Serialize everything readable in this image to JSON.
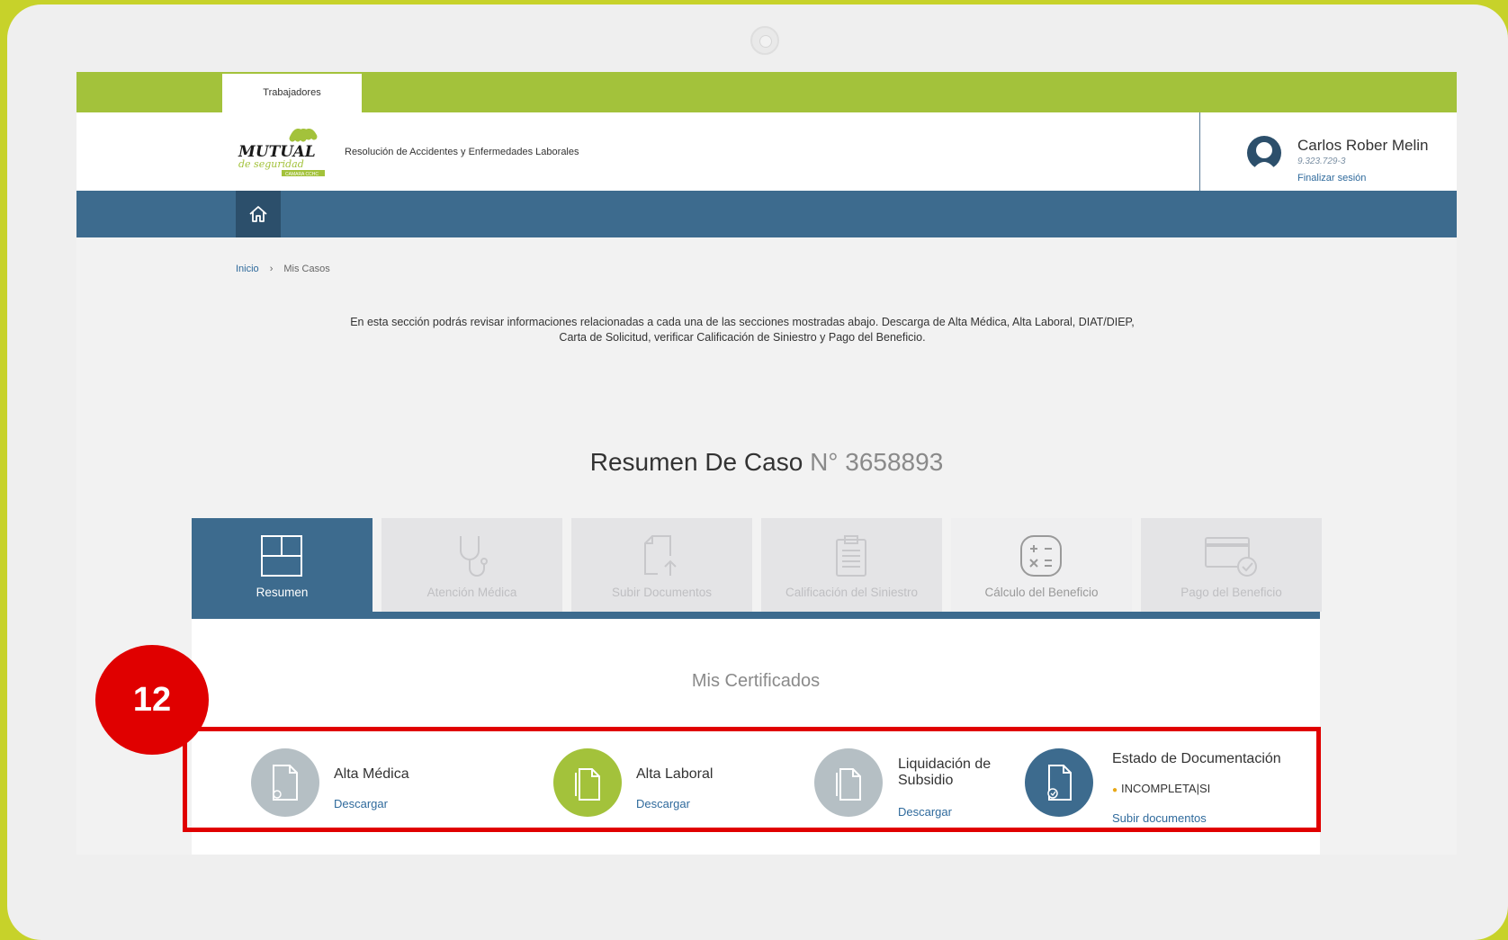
{
  "topbar": {
    "tab_label": "Trabajadores"
  },
  "header": {
    "logo": {
      "line1": "MUTUAL",
      "line2": "de seguridad",
      "tag": "CAMARA CCHC"
    },
    "subtitle": "Resolución de Accidentes y Enfermedades Laborales"
  },
  "user": {
    "name": "Carlos Rober Melin",
    "rut": "9.323.729-3",
    "logout_label": "Finalizar sesión"
  },
  "nav": {
    "home_icon": "home-icon"
  },
  "breadcrumb": {
    "home": "Inicio",
    "separator": "›",
    "current": "Mis Casos"
  },
  "intro": {
    "line1": "En esta sección podrás revisar informaciones relacionadas a cada una de las secciones mostradas abajo. Descarga de Alta Médica, Alta Laboral, DIAT/DIEP,",
    "line2": "Carta de Solicitud, verificar Calificación de Siniestro y Pago del Beneficio."
  },
  "case": {
    "title": "Resumen De Caso",
    "number": "N° 3658893"
  },
  "tabs": [
    {
      "label": "Resumen",
      "icon": "layout-grid-icon",
      "active": true
    },
    {
      "label": "Atención Médica",
      "icon": "stethoscope-icon",
      "active": false
    },
    {
      "label": "Subir Documentos",
      "icon": "upload-document-icon",
      "active": false
    },
    {
      "label": "Calificación del Siniestro",
      "icon": "clipboard-icon",
      "active": false
    },
    {
      "label": "Cálculo del Beneficio",
      "icon": "calculator-icon",
      "active": false
    },
    {
      "label": "Pago del Beneficio",
      "icon": "credit-card-icon",
      "active": false
    }
  ],
  "certificates": {
    "title": "Mis Certificados",
    "items": [
      {
        "name": "Alta Médica",
        "action": "Descargar",
        "color": "#b5bfc4"
      },
      {
        "name": "Alta Laboral",
        "action": "Descargar",
        "color": "#a3c23b"
      },
      {
        "name": "Liquidación de Subsidio",
        "action": "Descargar",
        "color": "#b5bfc4"
      }
    ],
    "documentation": {
      "name": "Estado de Documentación",
      "status": "INCOMPLETA|SI",
      "action": "Subir documentos",
      "color": "#3d6b8e"
    }
  },
  "annotation": {
    "step": "12"
  },
  "colors": {
    "brand_green": "#a3c23b",
    "brand_blue": "#3d6b8e",
    "highlight": "#e00000"
  }
}
